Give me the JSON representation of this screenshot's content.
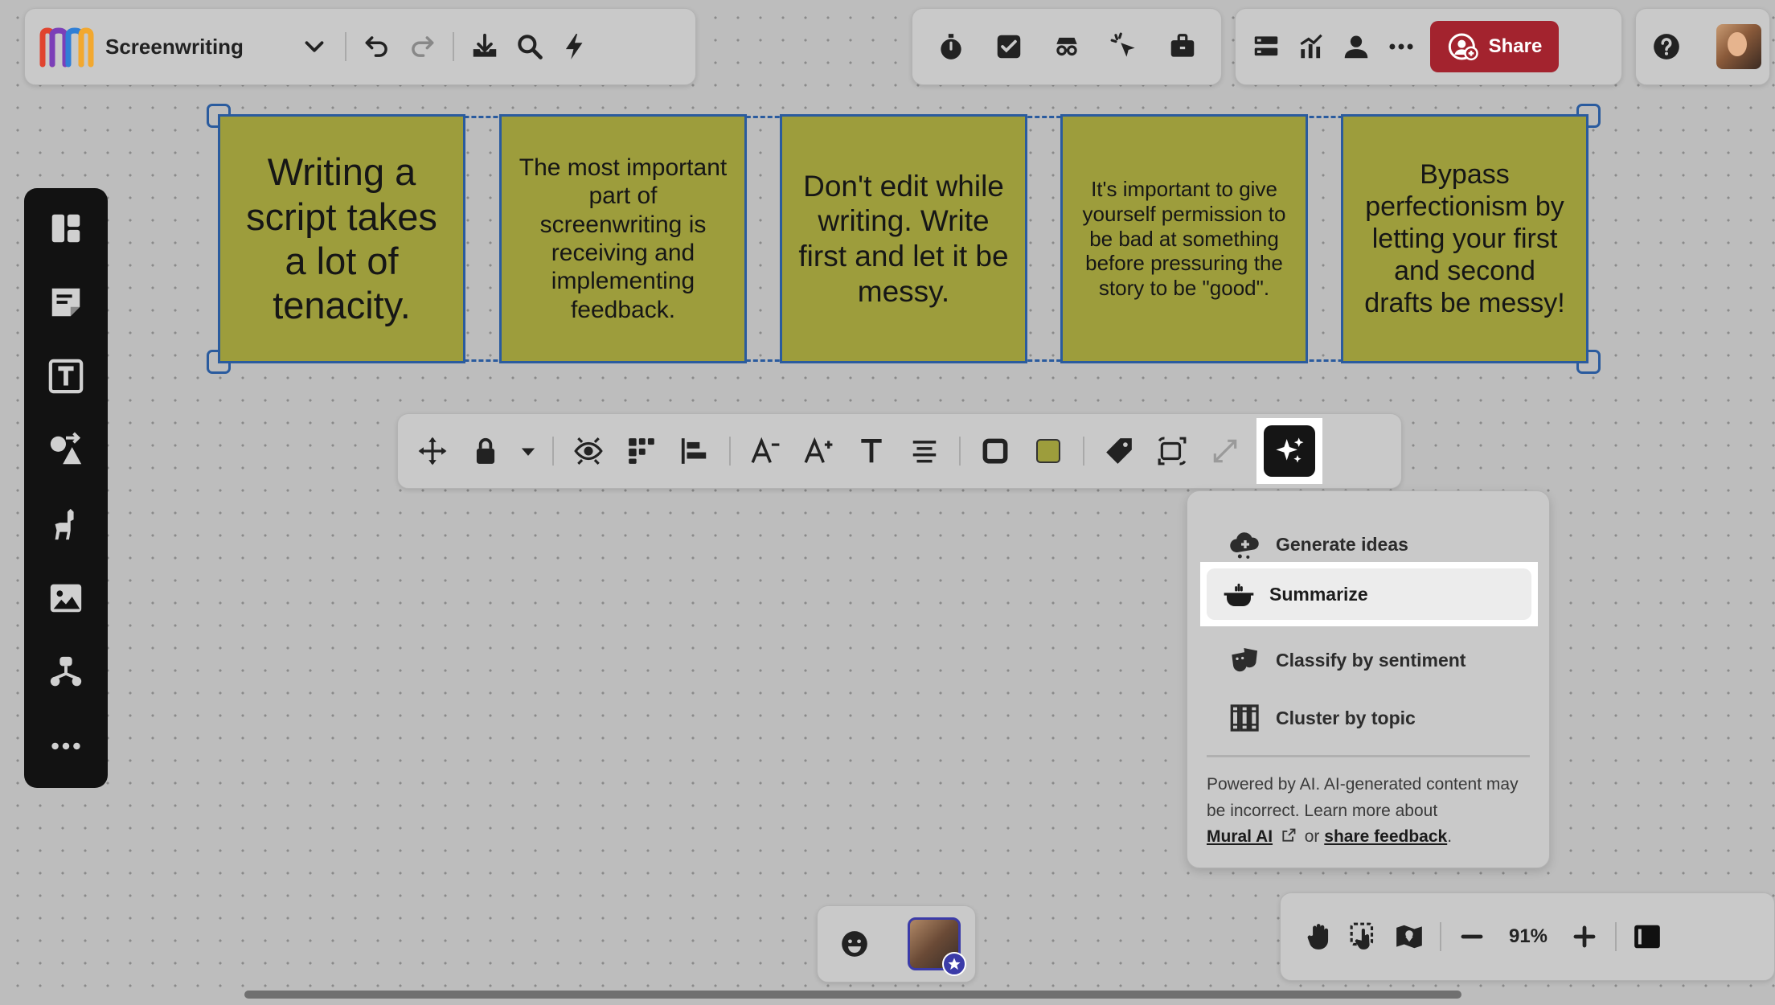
{
  "board": {
    "title": "Screenwriting"
  },
  "top_right": {
    "share_label": "Share"
  },
  "stickies": [
    {
      "text": "Writing a script takes a lot of tenacity."
    },
    {
      "text": "The most important part of screenwriting is receiving and implementing feedback."
    },
    {
      "text": "Don't edit while writing. Write first and let it be messy."
    },
    {
      "text": "It's important to give yourself permission to be bad at something before pressuring the story to be \"good\"."
    },
    {
      "text": "Bypass perfectionism by letting your first and second drafts be messy!"
    }
  ],
  "sticky_color": "#9d9d3c",
  "selection_color": "#2a5b9e",
  "ai_menu": {
    "items": [
      {
        "label": "Generate ideas",
        "icon": "cloud-plus-icon"
      },
      {
        "label": "Summarize",
        "icon": "pot-icon"
      },
      {
        "label": "Classify by sentiment",
        "icon": "theater-masks-icon"
      },
      {
        "label": "Cluster by topic",
        "icon": "books-icon"
      }
    ],
    "disclaimer_text": "Powered by AI. AI-generated content may be incorrect. Learn more about",
    "mural_ai_link": "Mural AI",
    "or_text": "or",
    "feedback_link": "share feedback",
    "period": "."
  },
  "zoom": {
    "level": "91%"
  },
  "colors": {
    "share": "#a3232e",
    "toolbar_dark": "#121212",
    "avatar_border": "#3b3ba8"
  }
}
